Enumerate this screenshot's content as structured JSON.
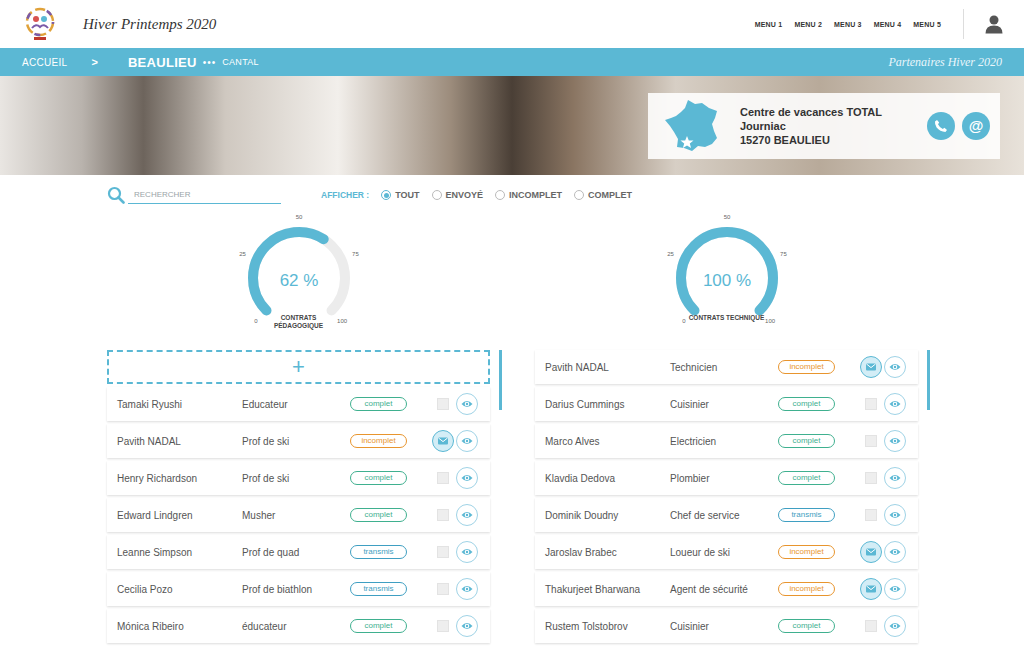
{
  "header": {
    "title": "Hiver Printemps 2020",
    "menu": [
      {
        "label": "MENU 1"
      },
      {
        "label": "MENU 2"
      },
      {
        "label": "MENU 3"
      },
      {
        "label": "MENU 4"
      },
      {
        "label": "MENU 5"
      }
    ]
  },
  "breadcrumb": {
    "home": "ACCUEIL",
    "separator": ">",
    "current": "BEAULIEU",
    "dots": "•••",
    "region": "CANTAL",
    "tagline": "Partenaires Hiver 2020"
  },
  "center": {
    "name": "Centre de vacances TOTAL",
    "locality": "Journiac",
    "city": "15270 BEAULIEU",
    "email_icon": "@"
  },
  "filter": {
    "placeholder": "RECHERCHER",
    "label": "AFFICHER :",
    "options": [
      {
        "label": "TOUT",
        "selected": true
      },
      {
        "label": "ENVOYÉ",
        "selected": false
      },
      {
        "label": "INCOMPLET",
        "selected": false
      },
      {
        "label": "COMPLET",
        "selected": false
      }
    ]
  },
  "panels": [
    {
      "gauge": {
        "value": "62 %",
        "level": 0.62,
        "label": "CONTRATS PÉDAGOGIQUE",
        "ticks": [
          "0",
          "25",
          "50",
          "75",
          "100"
        ]
      },
      "add": "+",
      "rows": [
        {
          "name": "Tamaki Ryushi",
          "role": "Educateur",
          "status": "complet",
          "color": "#3fb08f",
          "mail": false
        },
        {
          "name": "Pavith NADAL",
          "role": "Prof de ski",
          "status": "incomplet",
          "color": "#e8952e",
          "mail": true
        },
        {
          "name": "Henry Richardson",
          "role": "Prof de ski",
          "status": "complet",
          "color": "#3fb08f",
          "mail": false
        },
        {
          "name": "Edward Lindgren",
          "role": "Musher",
          "status": "complet",
          "color": "#3fb08f",
          "mail": false
        },
        {
          "name": "Leanne Simpson",
          "role": "Prof de quad",
          "status": "transmis",
          "color": "#3f9fc2",
          "mail": false
        },
        {
          "name": "Cecilia Pozo",
          "role": "Prof de biathlon",
          "status": "transmis",
          "color": "#3f9fc2",
          "mail": false
        },
        {
          "name": "Mónica Ribeiro",
          "role": "éducateur",
          "status": "complet",
          "color": "#3fb08f",
          "mail": false
        }
      ]
    },
    {
      "gauge": {
        "value": "100 %",
        "level": 1,
        "label": "CONTRATS TECHNIQUE",
        "ticks": [
          "0",
          "25",
          "50",
          "75",
          "100"
        ]
      },
      "rows": [
        {
          "name": "Pavith NADAL",
          "role": "Technicien",
          "status": "incomplet",
          "color": "#e8952e",
          "mail": true
        },
        {
          "name": "Darius Cummings",
          "role": "Cuisinier",
          "status": "complet",
          "color": "#3fb08f",
          "mail": false
        },
        {
          "name": "Marco Alves",
          "role": "Electricien",
          "status": "complet",
          "color": "#3fb08f",
          "mail": false
        },
        {
          "name": "Klavdia Dedova",
          "role": "Plombier",
          "status": "complet",
          "color": "#3fb08f",
          "mail": false
        },
        {
          "name": "Dominik Doudny",
          "role": "Chef de service",
          "status": "transmis",
          "color": "#3f9fc2",
          "mail": false
        },
        {
          "name": "Jaroslav Brabec",
          "role": "Loueur de ski",
          "status": "incomplet",
          "color": "#e8952e",
          "mail": true
        },
        {
          "name": "Thakurjeet Bharwana",
          "role": "Agent de sécurité",
          "status": "incomplet",
          "color": "#e8952e",
          "mail": true
        },
        {
          "name": "Rustem Tolstobrov",
          "role": "Cuisinier",
          "status": "complet",
          "color": "#3fb08f",
          "mail": false
        }
      ]
    }
  ]
}
